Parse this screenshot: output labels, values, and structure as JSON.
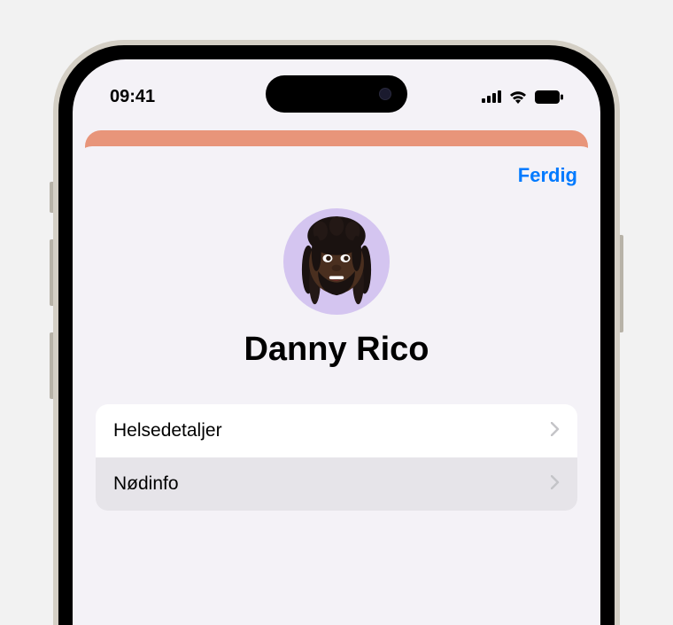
{
  "status_bar": {
    "time": "09:41"
  },
  "sheet": {
    "done_label": "Ferdig",
    "profile_name": "Danny Rico",
    "list_items": [
      {
        "label": "Helsedetaljer"
      },
      {
        "label": "Nødinfo"
      }
    ]
  }
}
